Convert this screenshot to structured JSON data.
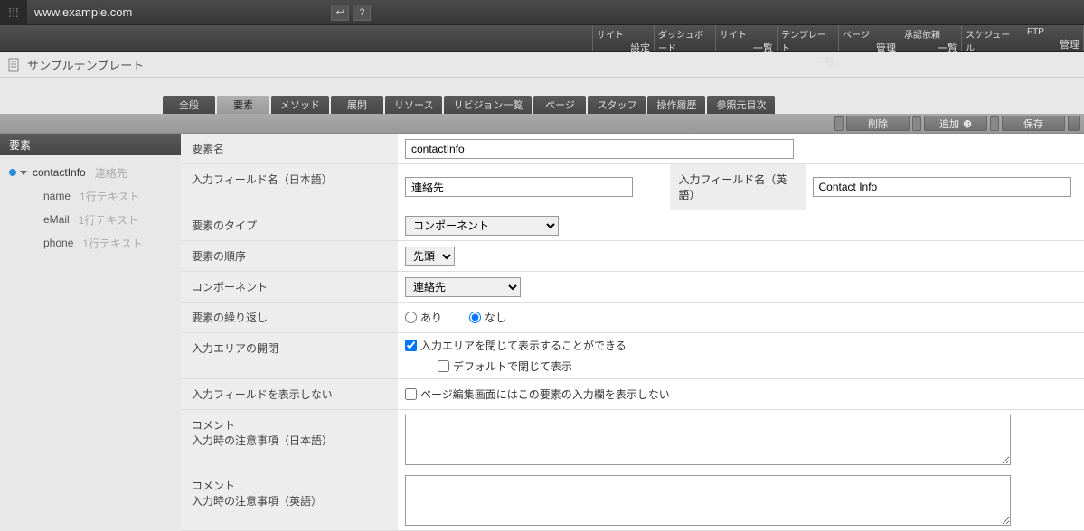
{
  "topbar": {
    "url": "www.example.com"
  },
  "nav": [
    {
      "top": "サイト",
      "bottom": "設定"
    },
    {
      "top": "ダッシュボード",
      "bottom": ""
    },
    {
      "top": "サイト",
      "bottom": "一覧"
    },
    {
      "top": "テンプレート",
      "bottom": "一覧"
    },
    {
      "top": "ページ",
      "bottom": "管理"
    },
    {
      "top": "承認依頼",
      "bottom": "一覧"
    },
    {
      "top": "スケジュール",
      "bottom": ""
    },
    {
      "top": "FTP",
      "bottom": "管理"
    }
  ],
  "title": "サンプルテンプレート",
  "tabs": [
    "全般",
    "要素",
    "メソッド",
    "展開",
    "リソース",
    "リビジョン一覧",
    "ページ",
    "スタッフ",
    "操作履歴",
    "参照元目次"
  ],
  "active_tab": "要素",
  "actions": {
    "delete": "削除",
    "add": "追加",
    "save": "保存"
  },
  "sidebar": {
    "header": "要素",
    "items": [
      {
        "label": "contactInfo",
        "sub": "連絡先",
        "root": true
      },
      {
        "label": "name",
        "sub": "1行テキスト"
      },
      {
        "label": "eMail",
        "sub": "1行テキスト"
      },
      {
        "label": "phone",
        "sub": "1行テキスト"
      }
    ]
  },
  "form": {
    "element_name": {
      "label": "要素名",
      "value": "contactInfo"
    },
    "field_jp": {
      "label": "入力フィールド名（日本語）",
      "value": "連絡先"
    },
    "field_en": {
      "label": "入力フィールド名（英語）",
      "value": "Contact Info"
    },
    "type": {
      "label": "要素のタイプ",
      "options": [
        "コンポーネント"
      ],
      "value": "コンポーネント"
    },
    "order": {
      "label": "要素の順序",
      "options": [
        "先頭"
      ],
      "value": "先頭"
    },
    "component": {
      "label": "コンポーネント",
      "options": [
        "連絡先"
      ],
      "value": "連絡先"
    },
    "repeat": {
      "label": "要素の繰り返し",
      "opt_yes": "あり",
      "opt_no": "なし",
      "value": "no"
    },
    "area_open": {
      "label": "入力エリアの開閉",
      "check1": "入力エリアを閉じて表示することができる",
      "check2": "デフォルトで閉じて表示"
    },
    "hide_field": {
      "label": "入力フィールドを表示しない",
      "check": "ページ編集画面にはこの要素の入力欄を表示しない"
    },
    "comment_jp": {
      "label1": "コメント",
      "label2": "入力時の注意事項（日本語）",
      "value": ""
    },
    "comment_en": {
      "label1": "コメント",
      "label2": "入力時の注意事項（英語）",
      "value": ""
    }
  }
}
